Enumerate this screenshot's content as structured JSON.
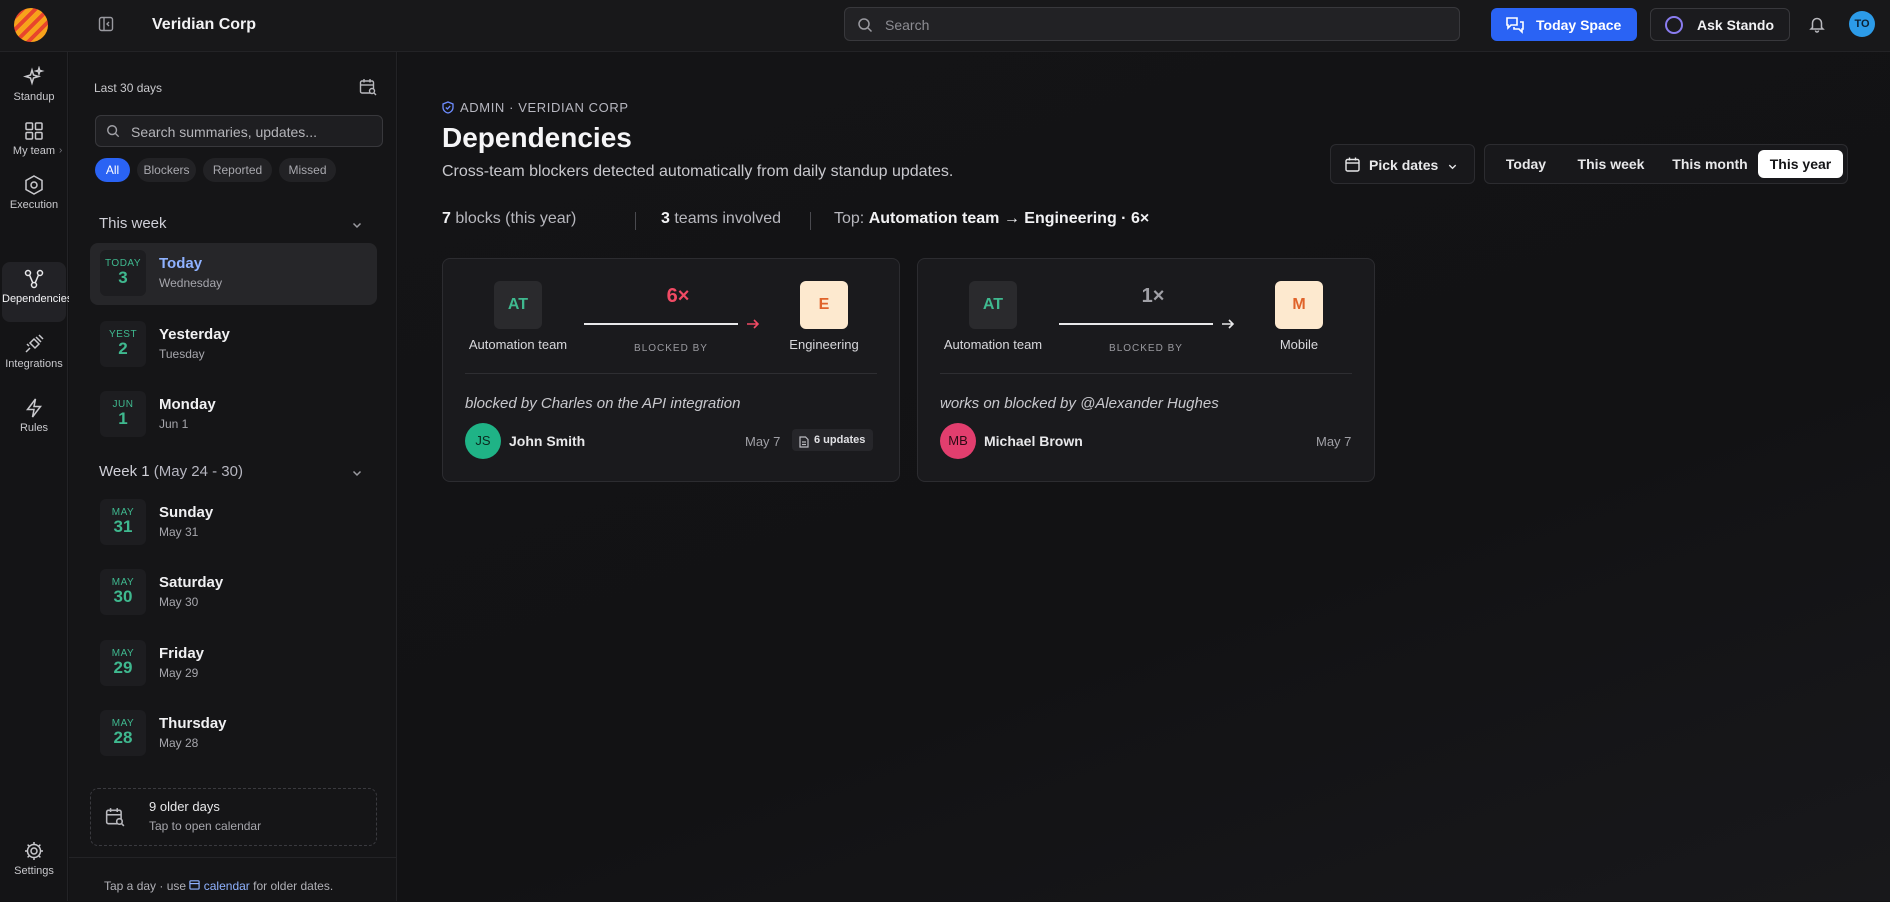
{
  "topbar": {
    "org_name": "Veridian Corp",
    "search_placeholder": "Search",
    "today_space_label": "Today Space",
    "ask_label": "Ask Stando",
    "avatar_initials": "TO"
  },
  "rail": {
    "items": [
      {
        "label": "Standup",
        "icon": "sparkle-icon"
      },
      {
        "label": "My team",
        "icon": "grid-icon"
      },
      {
        "label": "Execution",
        "icon": "hexagon-icon"
      },
      {
        "label": "Dependencies",
        "icon": "dependencies-icon"
      },
      {
        "label": "Integrations",
        "icon": "plug-icon"
      },
      {
        "label": "Rules",
        "icon": "bolt-icon"
      }
    ],
    "settings_label": "Settings",
    "active": "Dependencies"
  },
  "sidebar": {
    "range_label": "Last 30 days",
    "search_placeholder": "Search summaries, updates...",
    "filters": [
      "All",
      "Blockers",
      "Reported",
      "Missed"
    ],
    "active_filter": "All",
    "this_week": {
      "heading": "This week",
      "days": [
        {
          "tag": "TODAY",
          "num": "3",
          "name": "Today",
          "sub": "Wednesday"
        },
        {
          "tag": "YEST",
          "num": "2",
          "name": "Yesterday",
          "sub": "Tuesday"
        },
        {
          "tag": "JUN",
          "num": "1",
          "name": "Monday",
          "sub": "Jun 1"
        }
      ]
    },
    "week1": {
      "heading": "Week 1",
      "range": "(May 24 - 30)",
      "days": [
        {
          "tag": "MAY",
          "num": "31",
          "name": "Sunday",
          "sub": "May 31"
        },
        {
          "tag": "MAY",
          "num": "30",
          "name": "Saturday",
          "sub": "May 30"
        },
        {
          "tag": "MAY",
          "num": "29",
          "name": "Friday",
          "sub": "May 29"
        },
        {
          "tag": "MAY",
          "num": "28",
          "name": "Thursday",
          "sub": "May 28"
        }
      ]
    },
    "older": {
      "title": "9 older days",
      "sub": "Tap to open calendar"
    },
    "footer": {
      "before": "Tap a day · use",
      "link": "calendar",
      "after": "for older dates."
    }
  },
  "main": {
    "breadcrumb": "ADMIN · VERIDIAN CORP",
    "title": "Dependencies",
    "description": "Cross-team blockers detected automatically from daily standup updates.",
    "pick_dates_label": "Pick dates",
    "periods": [
      "Today",
      "This week",
      "This month",
      "This year"
    ],
    "active_period": "This year",
    "stats": {
      "blocks_count": "7",
      "blocks_label": "blocks (this year)",
      "teams_count": "3",
      "teams_label": "teams involved",
      "top_label": "Top:",
      "top_value": "Automation team → Engineering · 6×"
    },
    "cards": [
      {
        "from_initials": "AT",
        "from_name": "Automation team",
        "to_initials": "E",
        "to_name": "Engineering",
        "count": "6×",
        "count_color": "#f04a64",
        "arrow_color": "#f04a64",
        "relation": "BLOCKED BY",
        "quote": "blocked by Charles on the API integration",
        "person_initials": "JS",
        "person_name": "John Smith",
        "avatar_color": "#1fb386",
        "date": "May 7",
        "updates": "6 updates"
      },
      {
        "from_initials": "AT",
        "from_name": "Automation team",
        "to_initials": "M",
        "to_name": "Mobile",
        "count": "1×",
        "count_color": "#a0a0a6",
        "arrow_color": "#e8e8ea",
        "relation": "BLOCKED BY",
        "quote": "works on blocked by @Alexander Hughes",
        "person_initials": "MB",
        "person_name": "Michael Brown",
        "avatar_color": "#e23e6e",
        "date": "May 7"
      }
    ]
  }
}
